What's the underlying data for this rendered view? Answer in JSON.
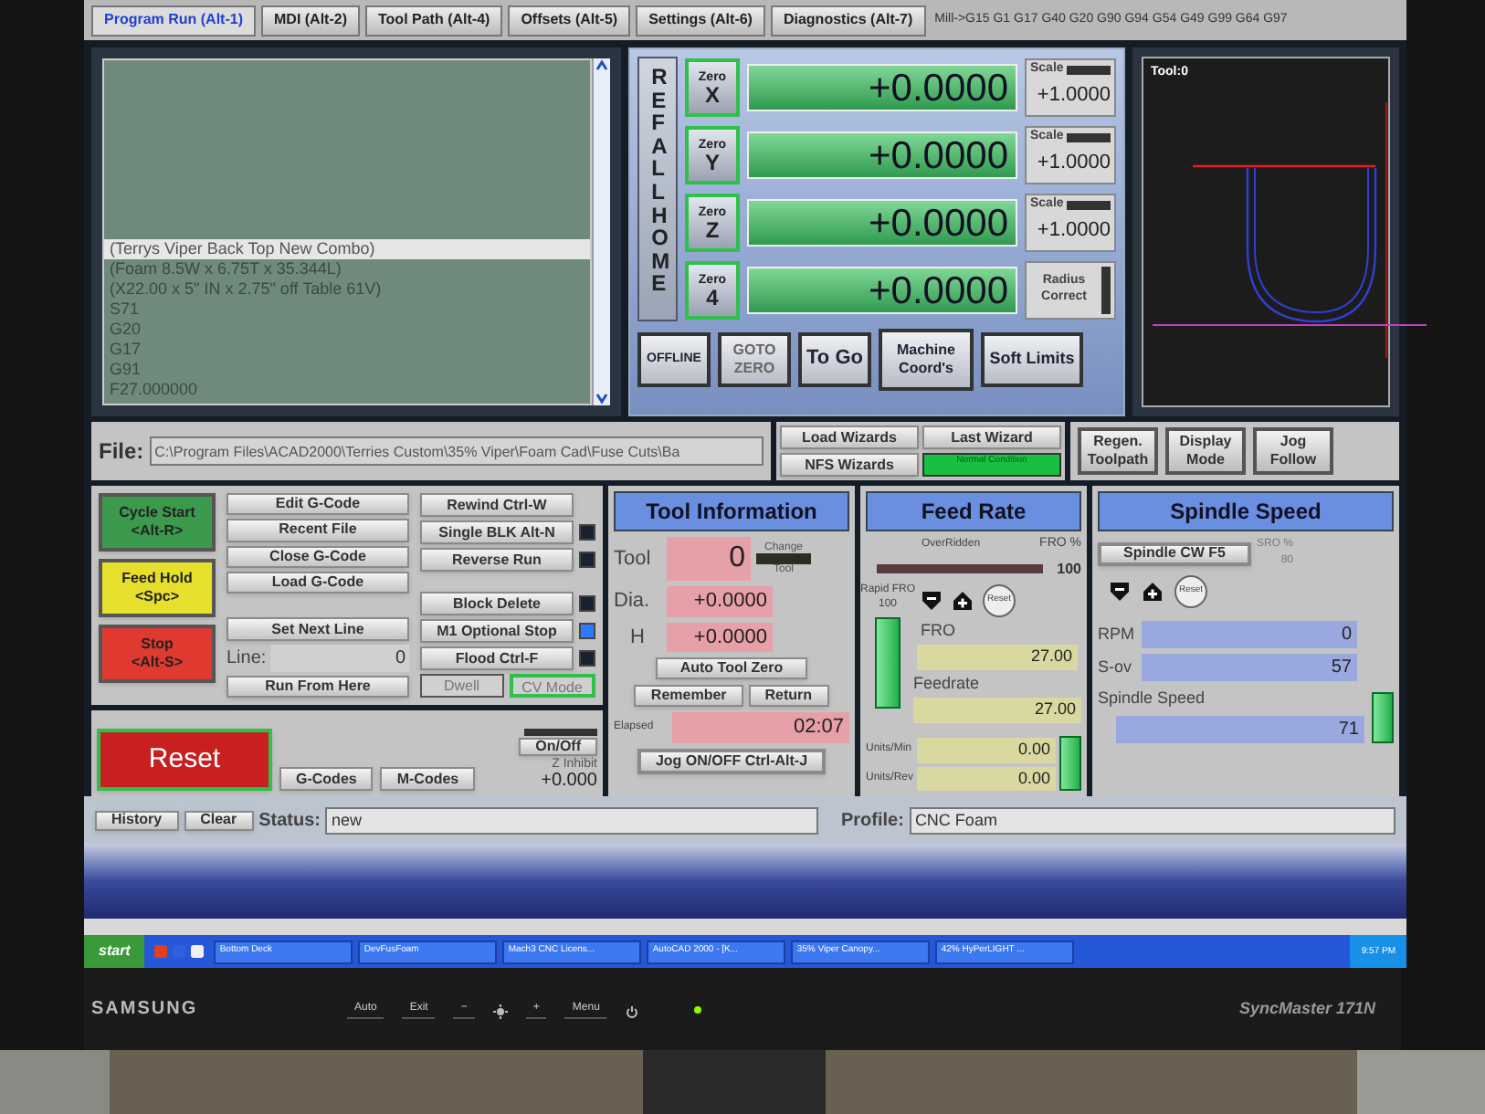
{
  "tabs": [
    {
      "label": "Program Run (Alt-1)",
      "selected": true
    },
    {
      "label": "MDI (Alt-2)",
      "selected": false
    },
    {
      "label": "Tool Path (Alt-4)",
      "selected": false
    },
    {
      "label": "Offsets (Alt-5)",
      "selected": false
    },
    {
      "label": "Settings (Alt-6)",
      "selected": false
    },
    {
      "label": "Diagnostics (Alt-7)",
      "selected": false
    }
  ],
  "modal_line": "Mill->G15  G1 G17 G40 G20 G90 G94 G54 G49 G99 G64 G97",
  "gcode_lines": [
    {
      "text": "(Terrys Viper Back Top New Combo)",
      "selected": true
    },
    {
      "text": "(Foam 8.5W x 6.75T x 35.344L)",
      "selected": false
    },
    {
      "text": "(X22.00 x 5\" IN x 2.75\" off Table 61V)",
      "selected": false
    },
    {
      "text": "S71",
      "selected": false
    },
    {
      "text": "G20",
      "selected": false
    },
    {
      "text": "G17",
      "selected": false
    },
    {
      "text": "G91",
      "selected": false
    },
    {
      "text": "F27.000000",
      "selected": false
    }
  ],
  "ref_all_home": "REF ALL HOME",
  "axes": [
    {
      "kind": "scale",
      "zero_label": "Zero",
      "axis": "X",
      "value": "+0.0000",
      "side_label": "Scale",
      "scale": "+1.0000"
    },
    {
      "kind": "scale",
      "zero_label": "Zero",
      "axis": "Y",
      "value": "+0.0000",
      "side_label": "Scale",
      "scale": "+1.0000"
    },
    {
      "kind": "scale",
      "zero_label": "Zero",
      "axis": "Z",
      "value": "+0.0000",
      "side_label": "Scale",
      "scale": "+1.0000"
    },
    {
      "kind": "radius",
      "zero_label": "Zero",
      "axis": "4",
      "value": "+0.0000",
      "side_label": "Radius Correct"
    }
  ],
  "dro_buttons": [
    "OFFLINE",
    "GOTO ZERO",
    "To Go",
    "Machine Coord's",
    "Soft Limits"
  ],
  "toolpath": {
    "label": "Tool:0"
  },
  "file": {
    "label": "File:",
    "path": "C:\\Program Files\\ACAD2000\\Terries Custom\\35% Viper\\Foam Cad\\Fuse Cuts\\Ba"
  },
  "wizards": [
    "Load Wizards",
    "Last Wizard",
    "NFS Wizards"
  ],
  "condition": "Normal Condition",
  "view_buttons": [
    "Regen. Toolpath",
    "Display Mode",
    "Jog Follow"
  ],
  "run_controls": [
    {
      "label": "Cycle Start",
      "key": "<Alt-R>",
      "color": "#3c9a4c"
    },
    {
      "label": "Feed Hold",
      "key": "<Spc>",
      "color": "#e6e02c"
    },
    {
      "label": "Stop",
      "key": "<Alt-S>",
      "color": "#e03a30"
    }
  ],
  "file_buttons": [
    "Edit G-Code",
    "Recent File",
    "Close G-Code",
    "Load G-Code"
  ],
  "set_next_line": "Set Next Line",
  "line": {
    "label": "Line:",
    "value": "0"
  },
  "run_from_here": "Run From Here",
  "rewind": "Rewind Ctrl-W",
  "toggles": [
    {
      "label": "Single BLK Alt-N",
      "on": false
    },
    {
      "label": "Reverse Run",
      "on": false
    },
    {
      "label": "Block Delete",
      "on": false
    },
    {
      "label": "M1 Optional Stop",
      "on": true
    },
    {
      "label": "Flood Ctrl-F",
      "on": false
    }
  ],
  "mode_boxes": [
    {
      "label": "Dwell",
      "on": false
    },
    {
      "label": "CV Mode",
      "on": true
    }
  ],
  "reset": "Reset",
  "code_buttons": [
    "G-Codes",
    "M-Codes"
  ],
  "z_inhibit": {
    "button": "On/Off",
    "label": "Z Inhibit",
    "value": "+0.000"
  },
  "tool_info": {
    "title": "Tool Information",
    "tool_label": "Tool",
    "tool": "0",
    "change": "Change",
    "change_sub": "Tool",
    "dia_label": "Dia.",
    "dia": "+0.0000",
    "h_label": "H",
    "h": "+0.0000",
    "auto_tool_zero": "Auto Tool Zero",
    "remember": "Remember",
    "return": "Return",
    "elapsed_label": "Elapsed",
    "elapsed": "02:07",
    "jog": "Jog ON/OFF Ctrl-Alt-J"
  },
  "feed_rate": {
    "title": "Feed Rate",
    "overridden": "OverRidden",
    "fro_pct_label": "FRO %",
    "fro_pct": "100",
    "rapid_label": "Rapid FRO",
    "rapid_value": "100",
    "reset": "Reset",
    "fro_label": "FRO",
    "fro": "27.00",
    "feedrate_label": "Feedrate",
    "feedrate": "27.00",
    "units_min_label": "Units/Min",
    "units_min": "0.00",
    "units_rev_label": "Units/Rev",
    "units_rev": "0.00",
    "rapid_slider": {
      "level": 1
    },
    "fro_slider": {
      "level": 1
    }
  },
  "spindle": {
    "title": "Spindle Speed",
    "cw": "Spindle CW F5",
    "sro_pct_label": "SRO %",
    "sro_pct": "80",
    "reset": "Reset",
    "rpm_label": "RPM",
    "rpm": "0",
    "sov_label": "S-ov",
    "sov": "57",
    "speed_label": "Spindle Speed",
    "speed": "71",
    "slider": {
      "level": 1
    }
  },
  "status": {
    "history": "History",
    "clear": "Clear",
    "status_label": "Status:",
    "status": "new",
    "profile_label": "Profile:",
    "profile": "CNC Foam"
  },
  "taskbar": {
    "start": "start",
    "items": [
      "Bottom Deck",
      "DevFusFoam",
      "Mach3 CNC Licens...",
      "AutoCAD 2000 - [K...",
      "35% Viper Canopy...",
      "42% HyPerLIGHT ..."
    ],
    "clock": "9:57 PM"
  },
  "monitor": {
    "brand": "SAMSUNG",
    "buttons": [
      "Auto",
      "Exit",
      "−",
      "+",
      "Menu"
    ],
    "model": "SyncMaster 171N"
  }
}
